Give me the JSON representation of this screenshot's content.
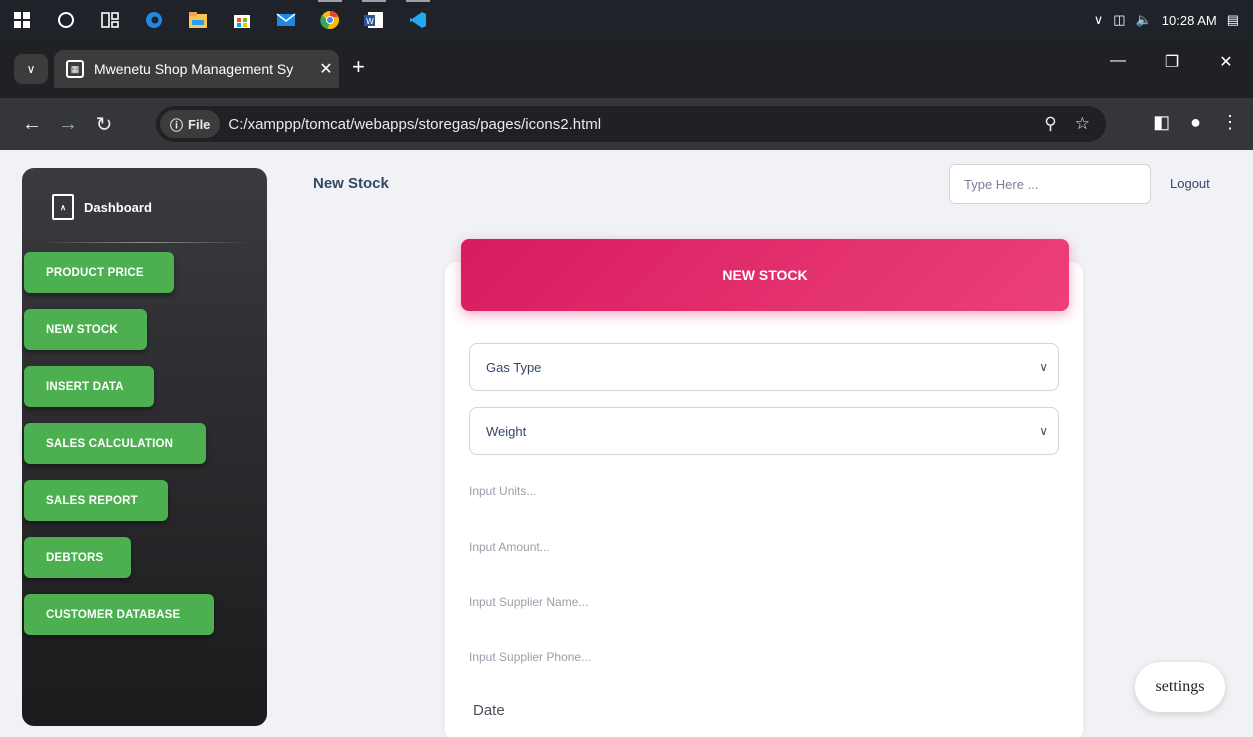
{
  "taskbar": {
    "icons": [
      "windows-start-icon",
      "search-circle-icon",
      "task-view-icon",
      "edge-icon",
      "file-explorer-icon",
      "store-icon",
      "mail-icon",
      "chrome-icon",
      "word-icon",
      "vscode-icon"
    ],
    "time": "10:28 AM"
  },
  "browser": {
    "tab_title": "Mwenetu Shop Management Sy",
    "address_chip": "File",
    "url": "C:/xamppp/tomcat/webapps/storegas/pages/icons2.html"
  },
  "sidebar": {
    "brand": "Dashboard",
    "items": [
      {
        "label": "PRODUCT PRICE"
      },
      {
        "label": "NEW STOCK"
      },
      {
        "label": "INSERT DATA"
      },
      {
        "label": "SALES CALCULATION"
      },
      {
        "label": "SALES REPORT"
      },
      {
        "label": "DEBTORS"
      },
      {
        "label": "CUSTOMER DATABASE"
      }
    ]
  },
  "header": {
    "page_title": "New Stock",
    "search_placeholder": "Type Here ...",
    "logout": "Logout"
  },
  "form": {
    "title": "NEW STOCK",
    "gas_type": "Gas Type",
    "weight": "Weight",
    "units_placeholder": "Input Units...",
    "amount_placeholder": "Input Amount...",
    "supplier_name_placeholder": "Input Supplier Name...",
    "supplier_phone_placeholder": "Input Supplier Phone...",
    "date_label": "Date"
  },
  "settings_label": "settings",
  "colors": {
    "accent_pink": "#e91e63",
    "sidebar_button_green": "#4caf50",
    "sidebar_dark": "#1b1b1d"
  }
}
